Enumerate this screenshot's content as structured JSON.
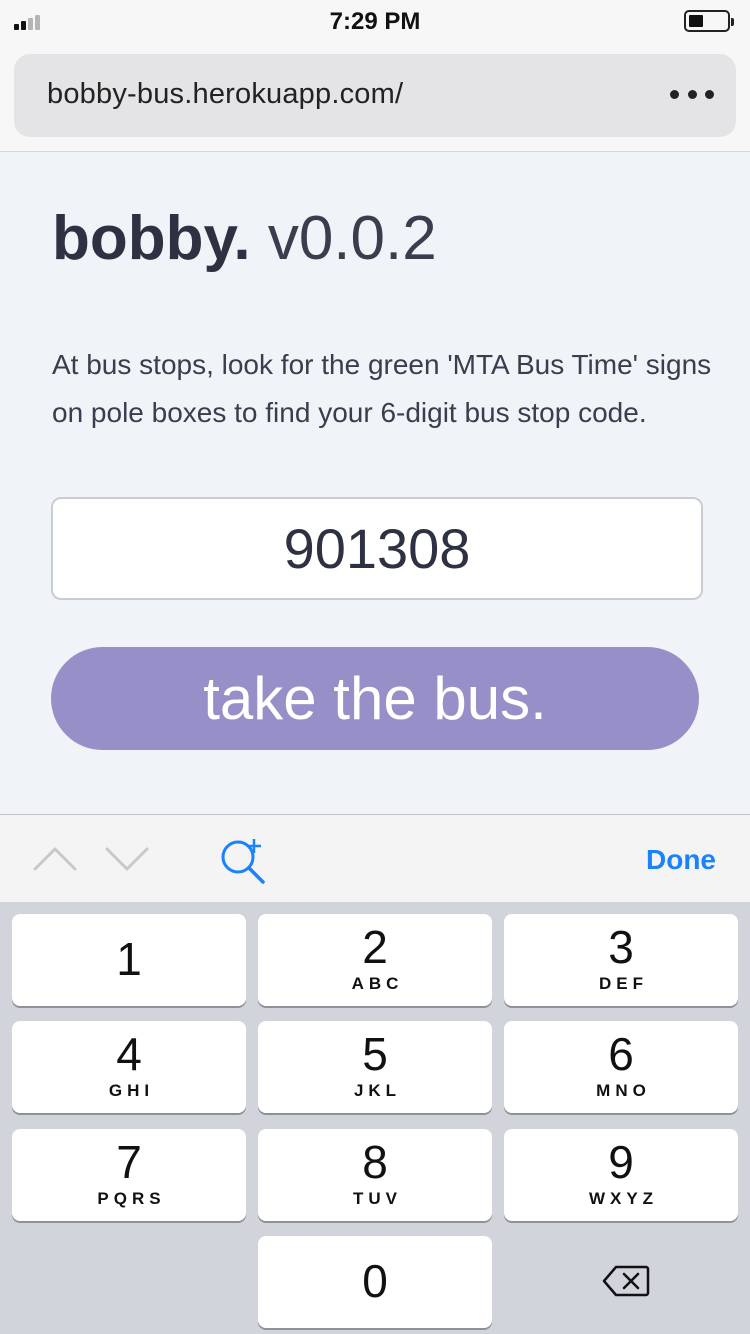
{
  "status_bar": {
    "time": "7:29 PM"
  },
  "browser": {
    "url": "bobby-bus.herokuapp.com/",
    "more_icon": "ellipsis-icon"
  },
  "app": {
    "brand": "bobby.",
    "version": "v0.0.2",
    "description": "At bus stops, look for the green 'MTA Bus Time' signs on pole boxes to find your 6-digit bus stop code.",
    "stop_code_value": "901308",
    "submit_label": "take the bus.",
    "button_color": "#978fc8"
  },
  "accessory_bar": {
    "prev_icon": "chevron-up-icon",
    "next_icon": "chevron-down-icon",
    "zoom_icon": "zoom-in-icon",
    "done_label": "Done",
    "accent_color": "#1a82fb"
  },
  "keypad": {
    "keys": [
      {
        "digit": "1",
        "letters": ""
      },
      {
        "digit": "2",
        "letters": "ABC"
      },
      {
        "digit": "3",
        "letters": "DEF"
      },
      {
        "digit": "4",
        "letters": "GHI"
      },
      {
        "digit": "5",
        "letters": "JKL"
      },
      {
        "digit": "6",
        "letters": "MNO"
      },
      {
        "digit": "7",
        "letters": "PQRS"
      },
      {
        "digit": "8",
        "letters": "TUV"
      },
      {
        "digit": "9",
        "letters": "WXYZ"
      },
      {
        "digit": "0",
        "letters": ""
      }
    ],
    "delete_icon": "backspace-icon"
  }
}
